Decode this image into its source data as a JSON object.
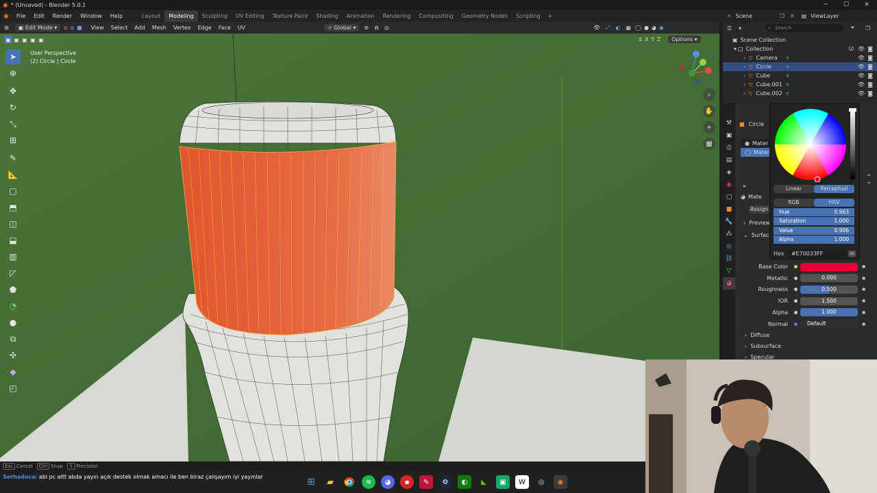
{
  "window": {
    "title": "* (Unsaved) - Blender 5.0.1"
  },
  "menus": [
    "File",
    "Edit",
    "Render",
    "Window",
    "Help"
  ],
  "workspaces": [
    {
      "label": "Layout",
      "active": false
    },
    {
      "label": "Modeling",
      "active": true
    },
    {
      "label": "Sculpting",
      "active": false
    },
    {
      "label": "UV Editing",
      "active": false
    },
    {
      "label": "Texture Paint",
      "active": false
    },
    {
      "label": "Shading",
      "active": false
    },
    {
      "label": "Animation",
      "active": false
    },
    {
      "label": "Rendering",
      "active": false
    },
    {
      "label": "Compositing",
      "active": false
    },
    {
      "label": "Geometry Nodes",
      "active": false
    },
    {
      "label": "Scripting",
      "active": false
    }
  ],
  "scene": {
    "name": "Scene",
    "view_layer": "ViewLayer"
  },
  "viewport_header": {
    "mode": "Edit Mode",
    "menus": [
      "View",
      "Select",
      "Add",
      "Mesh",
      "Vertex",
      "Edge",
      "Face",
      "UV"
    ],
    "orientation": "Global",
    "options": "Options"
  },
  "viewport": {
    "perspective": "User Perspective",
    "object_info": "(2) Circle | Circle",
    "axes": [
      "X",
      "Y",
      "Z"
    ],
    "colors": {
      "background": "#476f38",
      "selected_faces": "#e8663d",
      "mesh": "#dfe3dc",
      "floor": "#d6d8d4"
    }
  },
  "outliner": {
    "search_placeholder": "Search",
    "root": "Scene Collection",
    "collection": "Collection",
    "items": [
      {
        "name": "Camera",
        "selected": false
      },
      {
        "name": "Circle",
        "selected": true
      },
      {
        "name": "Cube",
        "selected": false
      },
      {
        "name": "Cube.001",
        "selected": false
      },
      {
        "name": "Cube.002",
        "selected": false
      }
    ]
  },
  "properties": {
    "object_name": "Circle",
    "material_slots": [
      "Mater",
      "Mater"
    ],
    "material_label": "Mate",
    "assign": "Assign",
    "preview": "Preview",
    "surface": "Surface",
    "rows": [
      {
        "label": "Base Color",
        "value": "",
        "type": "color"
      },
      {
        "label": "Metallic",
        "value": "0.000",
        "type": "field"
      },
      {
        "label": "Roughness",
        "value": "0.500",
        "type": "partial"
      },
      {
        "label": "IOR",
        "value": "1.500",
        "type": "field"
      },
      {
        "label": "Alpha",
        "value": "1.000",
        "type": "blue"
      },
      {
        "label": "Normal",
        "value": "Default",
        "type": "dark"
      }
    ],
    "sections": [
      "Diffuse",
      "Subsurface",
      "Specular"
    ],
    "base_color": "#e70033"
  },
  "color_picker": {
    "space_modes": [
      "Linear",
      "Perceptual"
    ],
    "active_space": "Perceptual",
    "models": [
      "RGB",
      "HSV"
    ],
    "active_model": "HSV",
    "sliders": [
      {
        "label": "Hue",
        "value": "0.963"
      },
      {
        "label": "Saturation",
        "value": "1.000"
      },
      {
        "label": "Value",
        "value": "0.906"
      },
      {
        "label": "Alpha",
        "value": "1.000"
      }
    ],
    "hex_label": "Hex",
    "hex_value": "#E70033FF"
  },
  "statusbar": {
    "items": [
      {
        "key": "Esc",
        "label": "Cancel"
      },
      {
        "key": "Ctrl",
        "label": "Snap"
      },
      {
        "key": "⇧",
        "label": "Precision"
      }
    ]
  },
  "chat": {
    "user": "Serhadoca",
    "message": ": abi pc altt abda yayın açık destek olmak amacı ile ben biraz çalışayım iyi yayınlar"
  }
}
